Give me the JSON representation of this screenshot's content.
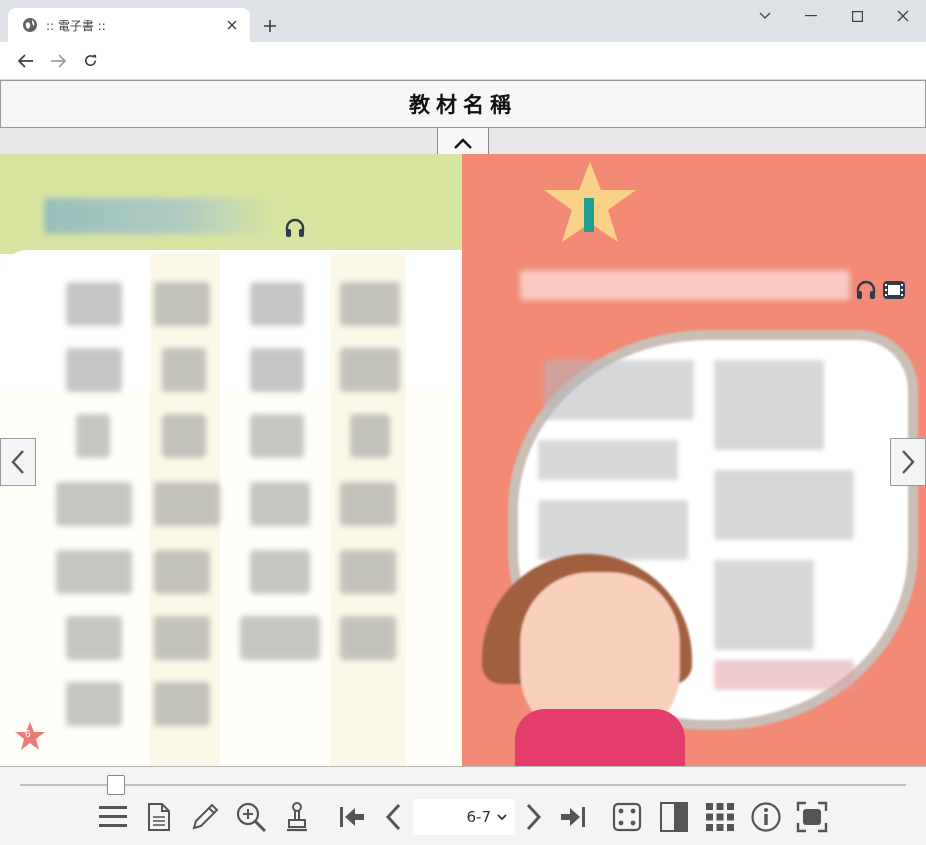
{
  "browser": {
    "tab_title": ":: 電子書 ::"
  },
  "app": {
    "title": "教材名稱"
  },
  "book": {
    "left_page_number": "6"
  },
  "toolbar": {
    "page_value": "6-7",
    "slider_position_fraction": 0.1
  },
  "colors": {
    "left_band": "#d8e5a1",
    "right_page": "#f28a76",
    "toolbar_bg": "#f4f4f4",
    "icon": "#555555"
  }
}
